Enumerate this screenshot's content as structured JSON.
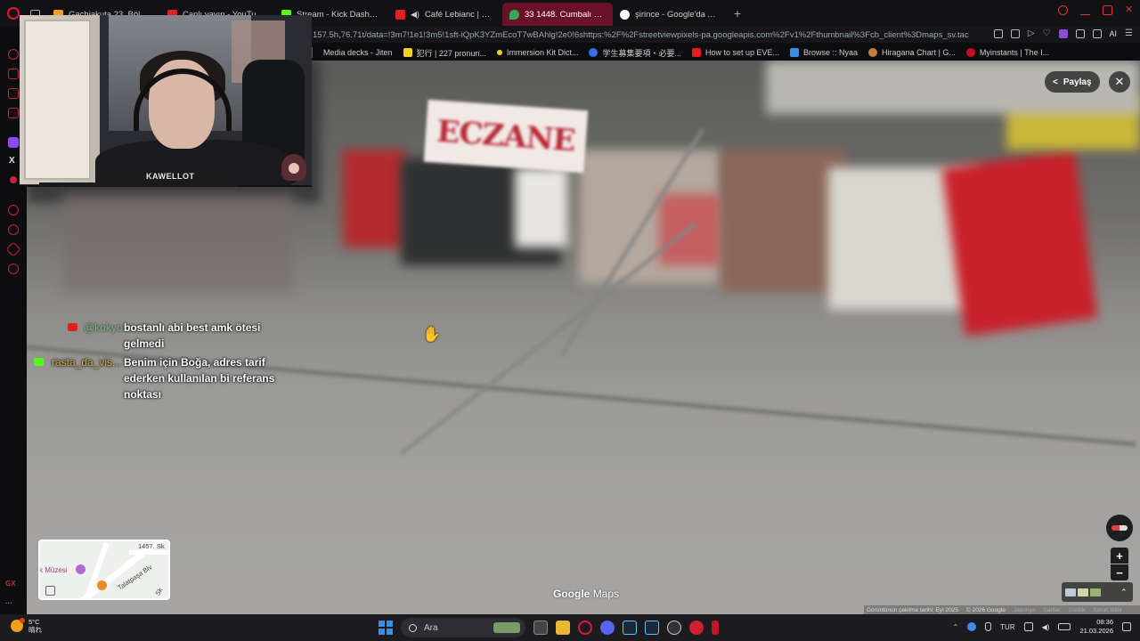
{
  "tabs": [
    {
      "label": "Gachiakuta 23. Bölüm izle",
      "color": "#f0a020",
      "active": false
    },
    {
      "label": "Canlı yayın - YouTube Stu",
      "color": "#e02020",
      "active": false
    },
    {
      "label": "Stream - Kick Dashboard",
      "color": "#53fc18",
      "active": false
    },
    {
      "label": "Café Lebianc | Coffee",
      "color": "#e02020",
      "active": false
    },
    {
      "label": "33 1448. Cumbalı Sk - Go",
      "color": "#34a853",
      "active": true
    },
    {
      "label": "şirince - Google'da Ara",
      "color": "#ffffff",
      "active": false
    }
  ],
  "address_bar": {
    "url": "157.5h,76.71t/data=!3m7!1e1!3m5!1sft-iQpK3YZmEcoT7wBAhlg!2e0!6shttps:%2F%2Fstreetviewpixels-pa.googleapis.com%2Fv1%2Fthumbnail%3Fcb_client%3Dmaps_sv.tactile%26",
    "ai_label": "AI"
  },
  "bookmarks": [
    {
      "label": "Media decks - Jiten",
      "color": "#ffffff"
    },
    {
      "label": "犯行 | 227 pronun...",
      "color": "#f5d020"
    },
    {
      "label": "Immersion Kit Dict...",
      "color": "#f5d020"
    },
    {
      "label": "学生募集要項・必要...",
      "color": "#3a6ee6"
    },
    {
      "label": "How to set up EVE...",
      "color": "#e02020"
    },
    {
      "label": "Browse :: Nyaa",
      "color": "#3a8ee6"
    },
    {
      "label": "Hiragana Chart | G...",
      "color": "#c08040"
    },
    {
      "label": "Myinstants | The I...",
      "color": "#c01020"
    }
  ],
  "sidebar": {
    "gx_label": "GX"
  },
  "streetview": {
    "sign_text": "ECZANE",
    "share_label": "Paylaş",
    "close_glyph": "✕",
    "zoom_in": "+",
    "zoom_out": "−",
    "logo_google": "Google",
    "logo_maps": "Maps",
    "attribution": {
      "capture_date": "Görüntünün çekilme tarihi: Eyl 2025",
      "copyright": "© 2026 Google",
      "country": "Japonya",
      "terms": "Şartlar",
      "privacy": "Gizlilik",
      "feedback": "Sorun bildir"
    },
    "minimap": {
      "street_label": "1457. Sk",
      "museum_label": "k Müzesi",
      "road_label": "Talatpaşa Blv",
      "side_label": "Sk"
    }
  },
  "webcam": {
    "streamer_name": "KAWELLOT"
  },
  "chat": [
    {
      "platform": "youtube",
      "user": "@kokyo",
      "user_color": "#6fcf6f",
      "text": "bostanlı abi best amk ötesi gelmedi"
    },
    {
      "platform": "kick",
      "user": "rasta_da_vis...",
      "user_color": "#c8b04a",
      "text": "Benim için Boğa, adres tarif ederken kullanılan bi referans noktası"
    }
  ],
  "taskbar": {
    "weather_temp": "5°C",
    "weather_desc": "晴れ",
    "search_placeholder": "Ara",
    "language": "TUR",
    "time": "08:36",
    "date": "21.03.2026"
  }
}
